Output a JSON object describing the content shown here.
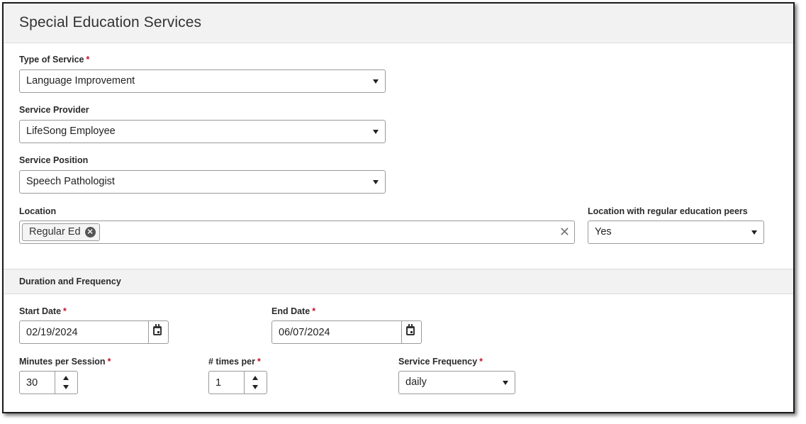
{
  "page": {
    "title": "Special Education Services"
  },
  "fields": {
    "type_of_service": {
      "label": "Type of Service",
      "required": "*",
      "value": "Language Improvement"
    },
    "service_provider": {
      "label": "Service Provider",
      "value": "LifeSong Employee"
    },
    "service_position": {
      "label": "Service Position",
      "value": "Speech Pathologist"
    },
    "location": {
      "label": "Location",
      "chips": [
        "Regular Ed"
      ],
      "chip_remove_icon": "⨯",
      "clear_icon": "✕"
    },
    "location_with_peers": {
      "label": "Location with regular education peers",
      "value": "Yes"
    }
  },
  "duration": {
    "section_title": "Duration and Frequency",
    "start_date": {
      "label": "Start Date",
      "required": "*",
      "value": "02/19/2024"
    },
    "end_date": {
      "label": "End Date",
      "required": "*",
      "value": "06/07/2024"
    },
    "minutes_per_session": {
      "label": "Minutes per Session",
      "required": "*",
      "value": "30"
    },
    "times_per": {
      "label": "# times per",
      "required": "*",
      "value": "1"
    },
    "service_frequency": {
      "label": "Service Frequency",
      "required": "*",
      "value": "daily"
    }
  },
  "icons": {
    "dropdown": "chevron-down-icon",
    "calendar": "calendar-icon",
    "spin_up": "spin-up-icon",
    "spin_down": "spin-down-icon"
  },
  "colors": {
    "required": "#c8102e",
    "header_bg": "#f2f2f2",
    "border": "#9a9a9a"
  }
}
